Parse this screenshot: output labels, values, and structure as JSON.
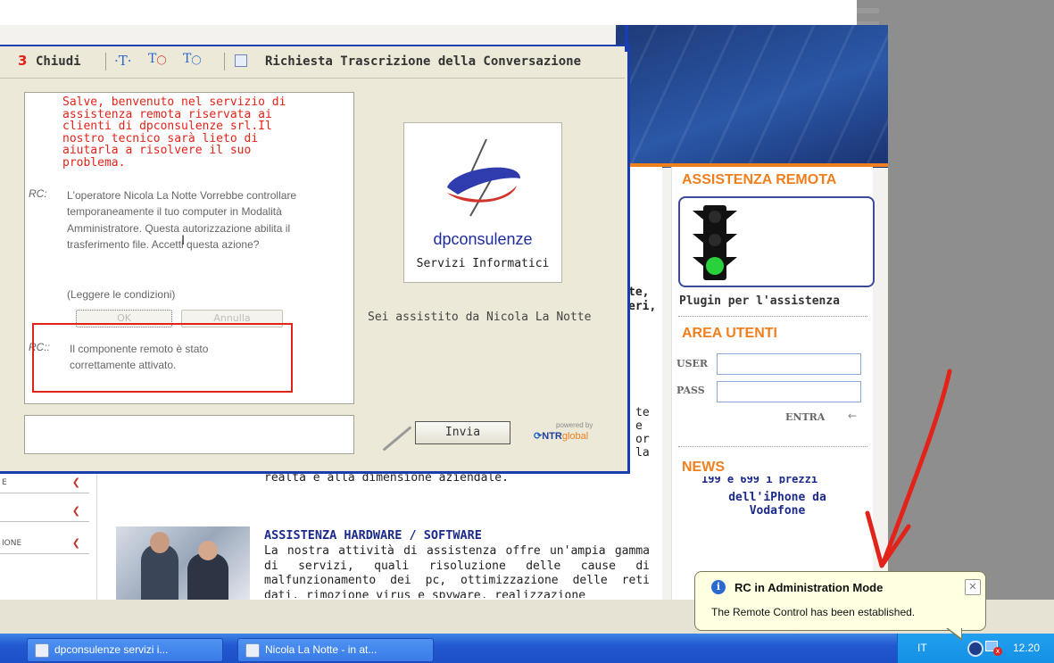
{
  "chat": {
    "toolbar": {
      "close_label": "Chiudi",
      "transcript_label": "Richiesta Trascrizione della Conversazione"
    },
    "messages": {
      "welcome": "Salve, benvenuto nel servizio di assistenza remota riservata ai clienti di dpconsulenze srl.Il nostro tecnico sarà lieto di aiutarla a risolvere il suo problema.",
      "rc_prefix_1": "RC:",
      "operator_request": "L'operatore Nicola La Notte Vorrebbe controllare temporaneamente il tuo computer in Modalità Amministratore. Questa autorizzazione abilita il trasferimento file. Accetti questa azione?",
      "conditions_link": "(Leggere le condizioni)",
      "ok_label": "OK",
      "cancel_label": "Annulla",
      "rc_prefix_2": "RC::",
      "activated": "Il componente remoto è stato correttamente attivato."
    },
    "logo": {
      "brand": "dpconsulenze",
      "tagline": "Servizi Informatici"
    },
    "assisted_by": "Sei assistito da Nicola La Notte",
    "send_label": "Invia",
    "powered_by": "powered by",
    "ntr_name_1": "NTR",
    "ntr_name_2": "global"
  },
  "site": {
    "right": {
      "assistenza_title": "ASSISTENZA REMOTA",
      "plugin_label": "Plugin per l'assistenza",
      "area_utenti_title": "AREA UTENTI",
      "user_label": "USER",
      "pass_label": "PASS",
      "entra_label": "ENTRA",
      "news_title": "NEWS",
      "news_partial": "199 e 699 i prezzi",
      "news_text": "dell'iPhone da Vodafone"
    },
    "main": {
      "partial_frag_1": "te,",
      "partial_frag_2": "eri,",
      "partial_frag_3": "te",
      "partial_frag_4": "e",
      "partial_frag_5": "or",
      "partial_frag_6": "la",
      "partial_line": "realtà e alla dimensione aziendale.",
      "hw_title": "ASSISTENZA HARDWARE / SOFTWARE",
      "hw_text": "La nostra attività di assistenza offre un'ampia gamma di servizi, quali risoluzione delle cause di malfunzionamento dei pc, ottimizzazione delle reti dati, rimozione virus e spyware, realizzazione"
    },
    "left_menu": {
      "item_1": "E",
      "item_3": "IONE"
    }
  },
  "balloon": {
    "title": "RC in Administration Mode",
    "text": "The Remote Control has been established."
  },
  "taskbar": {
    "tasks": [
      {
        "label": "dpconsulenze servizi i..."
      },
      {
        "label": "Nicola La Notte - in at..."
      }
    ],
    "language": "IT",
    "clock": "12.20"
  },
  "colors": {
    "accent_orange": "#f07f1e",
    "chat_border_blue": "#1a3db0",
    "alert_red": "#e2231a",
    "taskbar_blue": "#2258d0"
  }
}
